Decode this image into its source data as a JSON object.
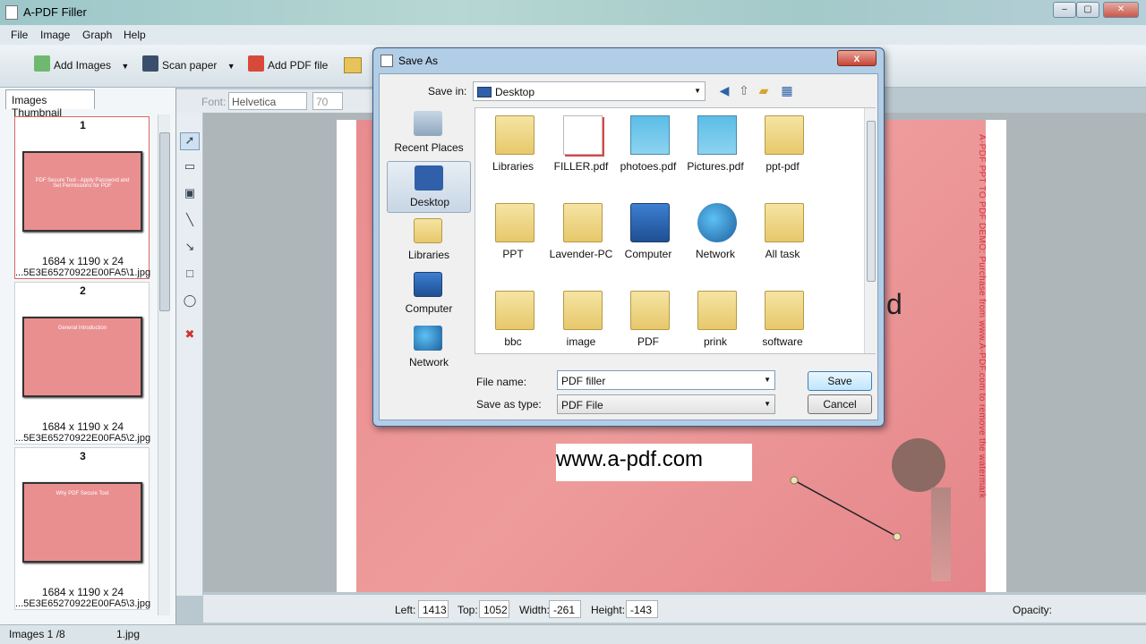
{
  "window": {
    "title": "A-PDF Filler",
    "min": "–",
    "max": "▢",
    "close": "✕"
  },
  "menu": [
    "File",
    "Image",
    "Graph",
    "Help"
  ],
  "toolbar": {
    "add_images": "Add Images",
    "scan_paper": "Scan paper",
    "add_pdf": "Add PDF file"
  },
  "left_panel": {
    "tab": "Images Thumbnail",
    "thumbs": [
      {
        "num": "1",
        "dims": "1684 x 1190 x 24",
        "path": "...5E3E65270922E00FA5\\1.jpg",
        "slide_text": "PDF Secure Tool - Apply Password and Set Permissions for PDF"
      },
      {
        "num": "2",
        "dims": "1684 x 1190 x 24",
        "path": "...5E3E65270922E00FA5\\2.jpg",
        "slide_text": "General Introduction"
      },
      {
        "num": "3",
        "dims": "1684 x 1190 x 24",
        "path": "...5E3E65270922E00FA5\\3.jpg",
        "slide_text": "Why PDF Secure Tool"
      }
    ]
  },
  "fontrow": {
    "label": "Font:",
    "font": "Helvetica",
    "size": "70"
  },
  "canvas": {
    "watermark": "A-PDF PPT TO PDF DEMO: Purchase from www.A-PDF.com to remove the watermark",
    "url_text": "www.a-pdf.com",
    "letter": "d"
  },
  "props": {
    "left_label": "Left:",
    "left": "1413",
    "top_label": "Top:",
    "top": "1052",
    "width_label": "Width:",
    "width": "-261",
    "height_label": "Height:",
    "height": "-143",
    "opacity_label": "Opacity:"
  },
  "status": {
    "images": "Images 1 /8",
    "file": "1.jpg"
  },
  "dialog": {
    "title": "Save As",
    "close": "x",
    "save_in_label": "Save in:",
    "save_in": "Desktop",
    "places": [
      "Recent Places",
      "Desktop",
      "Libraries",
      "Computer",
      "Network"
    ],
    "files": [
      {
        "name": "Libraries",
        "kind": "folder"
      },
      {
        "name": "FILLER.pdf",
        "kind": "pdf"
      },
      {
        "name": "photoes.pdf",
        "kind": "pdfsky"
      },
      {
        "name": "Pictures.pdf",
        "kind": "pdfsky"
      },
      {
        "name": "ppt-pdf",
        "kind": "folder"
      },
      {
        "name": "PPT",
        "kind": "folder"
      },
      {
        "name": "Lavender-PC",
        "kind": "folder"
      },
      {
        "name": "Computer",
        "kind": "pc"
      },
      {
        "name": "Network",
        "kind": "globe"
      },
      {
        "name": "All task",
        "kind": "folder"
      },
      {
        "name": "bbc",
        "kind": "folder"
      },
      {
        "name": "image",
        "kind": "folder"
      },
      {
        "name": "PDF",
        "kind": "folder"
      },
      {
        "name": "prink",
        "kind": "folder"
      },
      {
        "name": "software",
        "kind": "folder"
      }
    ],
    "file_name_label": "File name:",
    "file_name": "PDF filler",
    "save_type_label": "Save as type:",
    "save_type": "PDF File",
    "save_btn": "Save",
    "cancel_btn": "Cancel"
  }
}
